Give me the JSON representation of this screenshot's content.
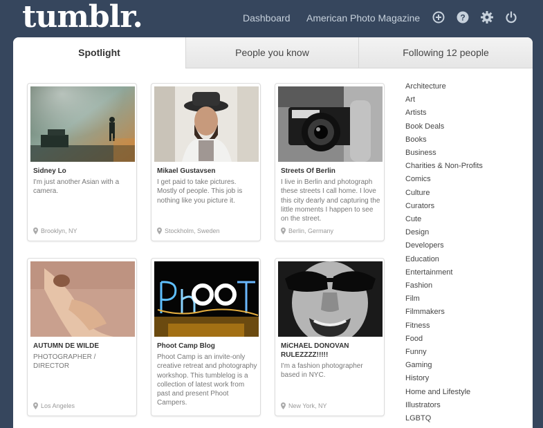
{
  "header": {
    "logo": "tumblr.",
    "nav": {
      "dashboard": "Dashboard",
      "blog": "American Photo Magazine"
    },
    "icons": [
      "plus-circle-icon",
      "help-icon",
      "gear-icon",
      "power-icon"
    ]
  },
  "tabs": [
    {
      "label": "Spotlight",
      "active": true
    },
    {
      "label": "People you know",
      "active": false
    },
    {
      "label": "Following 12 people",
      "active": false
    }
  ],
  "cards": [
    {
      "name": "Sidney Lo",
      "desc": "I'm just another Asian with a camera.",
      "location": "Brooklyn, NY"
    },
    {
      "name": "Mikael Gustavsen",
      "desc": "I get paid to take pictures. Mostly of people. This job is nothing like you picture it.",
      "location": "Stockholm, Sweden"
    },
    {
      "name": "Streets Of Berlin",
      "desc": "I live in Berlin and photograph these streets I call home. I love this city dearly and capturing the little moments I happen to see on the street.",
      "location": "Berlin, Germany"
    },
    {
      "name": "AUTUMN DE WILDE",
      "desc": "PHOTOGRAPHER / DIRECTOR",
      "location": "Los Angeles"
    },
    {
      "name": "Phoot Camp Blog",
      "desc": "Phoot Camp is an invite-only creative retreat and photography workshop. This tumblelog is a collection of latest work from past and present Phoot Campers.",
      "location": ""
    },
    {
      "name": "MiCHAEL DONOVAN RULEZZZZ!!!!!",
      "desc": "I'm a fashion photographer based in NYC.",
      "location": "New York, NY"
    }
  ],
  "categories": [
    "Architecture",
    "Art",
    "Artists",
    "Book Deals",
    "Books",
    "Business",
    "Charities & Non-Profits",
    "Comics",
    "Culture",
    "Curators",
    "Cute",
    "Design",
    "Developers",
    "Education",
    "Entertainment",
    "Fashion",
    "Film",
    "Filmmakers",
    "Fitness",
    "Food",
    "Funny",
    "Gaming",
    "History",
    "Home and Lifestyle",
    "Illustrators",
    "LGBTQ"
  ],
  "colors": {
    "background": "#36465d",
    "panel": "#ffffff",
    "nav_text": "#c7d1dc"
  }
}
